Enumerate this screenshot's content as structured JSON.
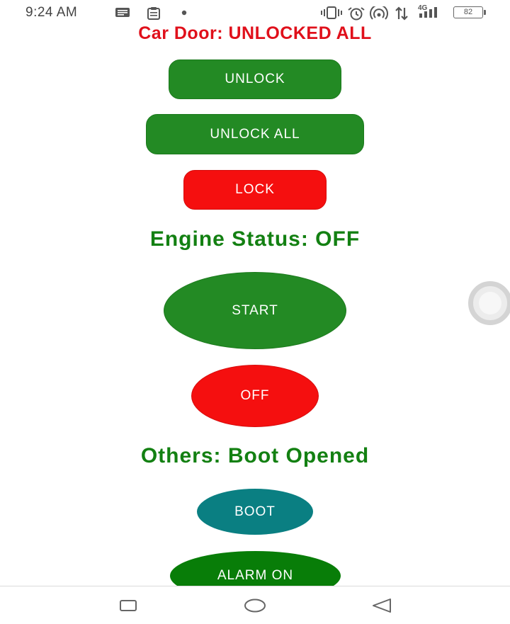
{
  "status_bar": {
    "time": "9:24 AM",
    "network_label": "4G",
    "battery": "82"
  },
  "car_door": {
    "status_text": "Car Door: UNLOCKED ALL",
    "unlock_label": "UNLOCK",
    "unlock_all_label": "UNLOCK ALL",
    "lock_label": "LOCK"
  },
  "engine": {
    "status_text": "Engine Status: OFF",
    "start_label": "START",
    "off_label": "OFF"
  },
  "others": {
    "status_text": "Others: Boot Opened",
    "boot_label": "BOOT",
    "alarm_label": "ALARM ON"
  },
  "icons": {
    "status": [
      "message-icon",
      "clipboard-icon",
      "dot-icon",
      "vibrate-icon",
      "alarm-icon",
      "hotspot-icon",
      "data-arrows-icon",
      "signal-icon",
      "battery-icon"
    ],
    "nav": [
      "recents-square-icon",
      "home-circle-icon",
      "back-triangle-icon"
    ],
    "floating": "floating-assist-handle"
  },
  "colors": {
    "green": "#238a24",
    "red": "#f50f0f",
    "teal": "#0a7f82",
    "heading_red": "#e0101b",
    "heading_green": "#138012"
  }
}
